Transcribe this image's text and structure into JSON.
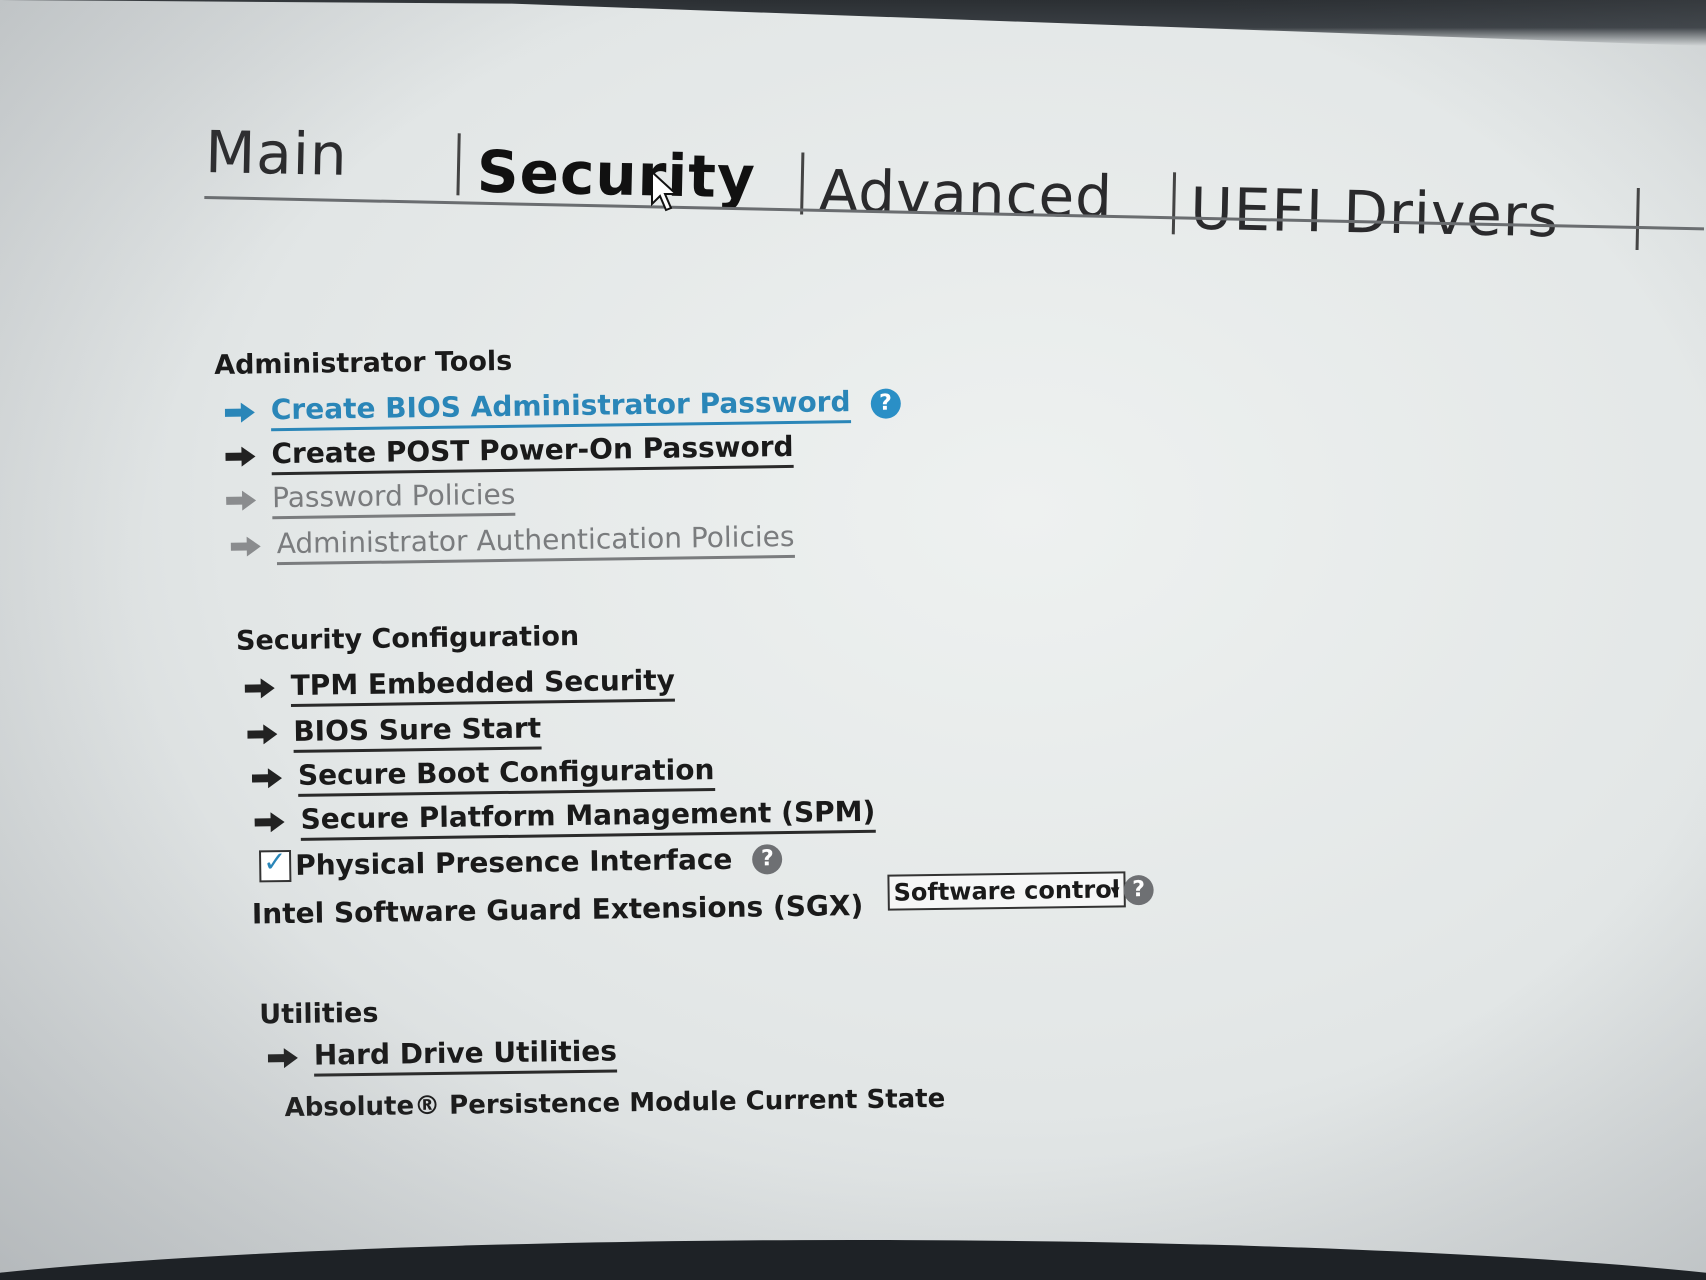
{
  "tabs": [
    {
      "label": "Main"
    },
    {
      "label": "Security"
    },
    {
      "label": "Advanced"
    },
    {
      "label": "UEFI Drivers"
    }
  ],
  "active_tab": "Security",
  "sections": {
    "admin": {
      "title": "Administrator Tools",
      "items": [
        {
          "label": "Create BIOS Administrator Password",
          "state": "highlight"
        },
        {
          "label": "Create POST Power-On Password",
          "state": "normal"
        },
        {
          "label": "Password Policies",
          "state": "disabled"
        },
        {
          "label": "Administrator Authentication Policies",
          "state": "disabled"
        }
      ]
    },
    "security": {
      "title": "Security Configuration",
      "items": [
        {
          "label": "TPM Embedded Security"
        },
        {
          "label": "BIOS Sure Start"
        },
        {
          "label": "Secure Boot Configuration"
        },
        {
          "label": "Secure Platform Management (SPM)"
        }
      ],
      "ppi": {
        "label": "Physical Presence Interface",
        "checked": true
      },
      "sgx": {
        "label": "Intel Software Guard Extensions (SGX)",
        "value": "Software control"
      }
    },
    "utilities": {
      "title": "Utilities",
      "items": [
        {
          "label": "Hard Drive Utilities"
        }
      ],
      "absolute": {
        "label": "Absolute® Persistence Module Current State"
      }
    }
  },
  "icons": {
    "arrow": "right-arrow-icon",
    "help": "question-mark-icon",
    "check": "checkmark-icon",
    "cursor": "mouse-pointer-icon"
  },
  "colors": {
    "highlight": "#2a86b8",
    "help_blue": "#2a8fc6",
    "help_grey": "#6e7073",
    "disabled": "#7a7c7e"
  }
}
